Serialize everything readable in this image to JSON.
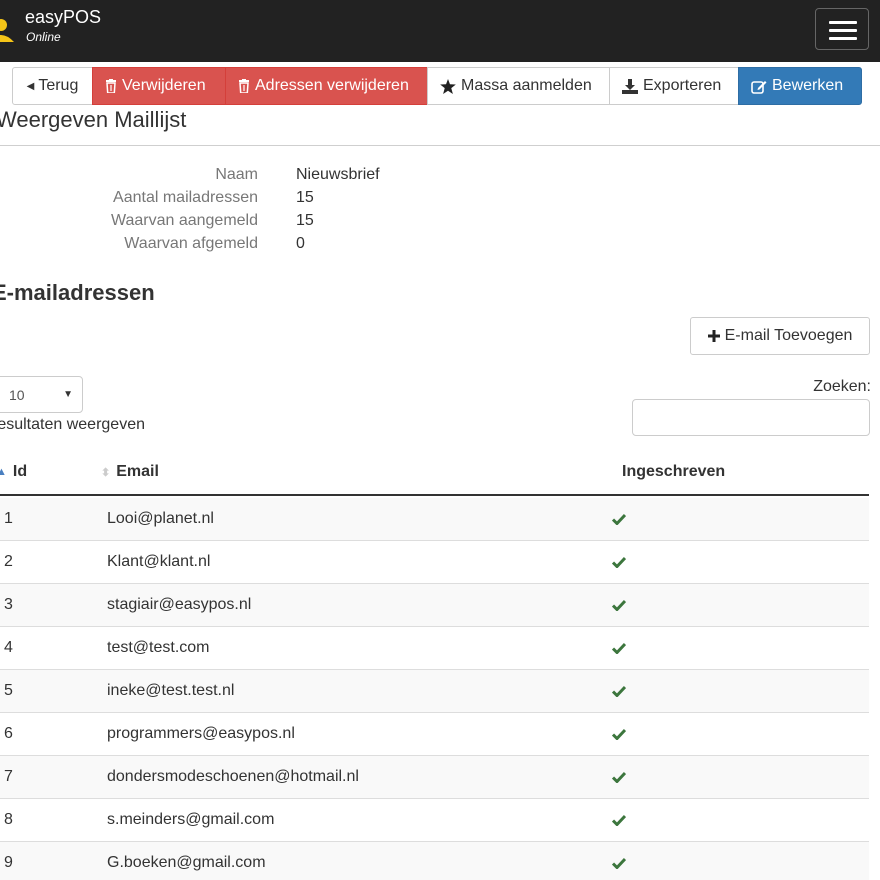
{
  "navbar": {
    "brand": "easyPOS",
    "brand_sub": "Online",
    "logo_color": "#f5c518",
    "menu_icon": "hamburger-icon"
  },
  "toolbar": {
    "back_label": "Terug",
    "delete_label": "Verwijderen",
    "delete_addresses_label": "Adressen verwijderen",
    "mass_signup_label": "Massa aanmelden",
    "export_label": "Exporteren",
    "edit_label": "Bewerken",
    "colors": {
      "danger": "#d9534f",
      "primary": "#337ab7"
    }
  },
  "page": {
    "title": "Weergeven Maillijst"
  },
  "details": [
    {
      "label": "Naam",
      "value": "Nieuwsbrief"
    },
    {
      "label": "Aantal mailadressen",
      "value": "15"
    },
    {
      "label": "Waarvan aangemeld",
      "value": "15"
    },
    {
      "label": "Waarvan afgemeld",
      "value": "0"
    }
  ],
  "emails": {
    "section_title": "E-mailadressen",
    "add_button_label": "E-mail Toevoegen",
    "page_length": "10",
    "page_length_label": "resultaten weergeven",
    "search_label": "Zoeken:",
    "search_value": "",
    "columns": {
      "id": "Id",
      "email": "Email",
      "subscribed": "Ingeschreven"
    },
    "check_color": "#3c763d",
    "rows": [
      {
        "id": "1",
        "email": "Looi@planet.nl",
        "subscribed": true
      },
      {
        "id": "2",
        "email": "Klant@klant.nl",
        "subscribed": true
      },
      {
        "id": "3",
        "email": "stagiair@easypos.nl",
        "subscribed": true
      },
      {
        "id": "4",
        "email": "test@test.com",
        "subscribed": true
      },
      {
        "id": "5",
        "email": "ineke@test.test.nl",
        "subscribed": true
      },
      {
        "id": "6",
        "email": "programmers@easypos.nl",
        "subscribed": true
      },
      {
        "id": "7",
        "email": "dondersmodeschoenen@hotmail.nl",
        "subscribed": true
      },
      {
        "id": "8",
        "email": "s.meinders@gmail.com",
        "subscribed": true
      },
      {
        "id": "9",
        "email": "G.boeken@gmail.com",
        "subscribed": true
      }
    ]
  }
}
